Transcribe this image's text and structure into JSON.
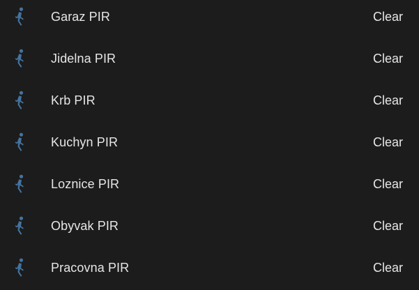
{
  "entities": [
    {
      "name": "Garaz PIR",
      "state": "Clear",
      "icon": "motion-sensor-walk-icon"
    },
    {
      "name": "Jidelna PIR",
      "state": "Clear",
      "icon": "motion-sensor-walk-icon"
    },
    {
      "name": "Krb PIR",
      "state": "Clear",
      "icon": "motion-sensor-walk-icon"
    },
    {
      "name": "Kuchyn PIR",
      "state": "Clear",
      "icon": "motion-sensor-walk-icon"
    },
    {
      "name": "Loznice PIR",
      "state": "Clear",
      "icon": "motion-sensor-walk-icon"
    },
    {
      "name": "Obyvak PIR",
      "state": "Clear",
      "icon": "motion-sensor-walk-icon"
    },
    {
      "name": "Pracovna PIR",
      "state": "Clear",
      "icon": "motion-sensor-walk-icon"
    }
  ],
  "colors": {
    "background": "#1c1c1c",
    "icon": "#44739e",
    "text": "#e6e6e6"
  }
}
